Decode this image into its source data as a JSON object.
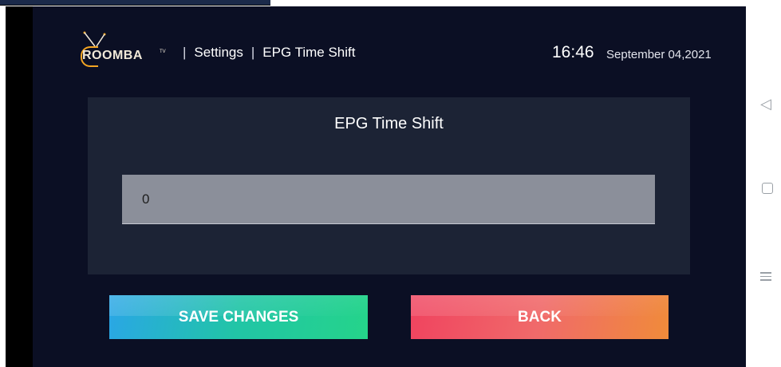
{
  "brand": {
    "name": "ROOMBA",
    "tm": "TV"
  },
  "header": {
    "separator": "|",
    "crumbs": [
      "Settings",
      "EPG Time Shift"
    ],
    "time": "16:46",
    "date": "September 04,2021"
  },
  "panel": {
    "title": "EPG Time Shift",
    "shift_value": "0"
  },
  "actions": {
    "save_label": "SAVE CHANGES",
    "back_label": "BACK"
  },
  "colors": {
    "background": "#0b0f24",
    "panel": "#1c2335",
    "logo_accent": "#f5a623",
    "save_gradient": [
      "#2aa6e6",
      "#25d48a"
    ],
    "back_gradient": [
      "#f0435f",
      "#f08b3a"
    ]
  },
  "system_nav": {
    "icons": [
      "back-triangle-icon",
      "home-square-icon",
      "recents-menu-icon"
    ]
  }
}
